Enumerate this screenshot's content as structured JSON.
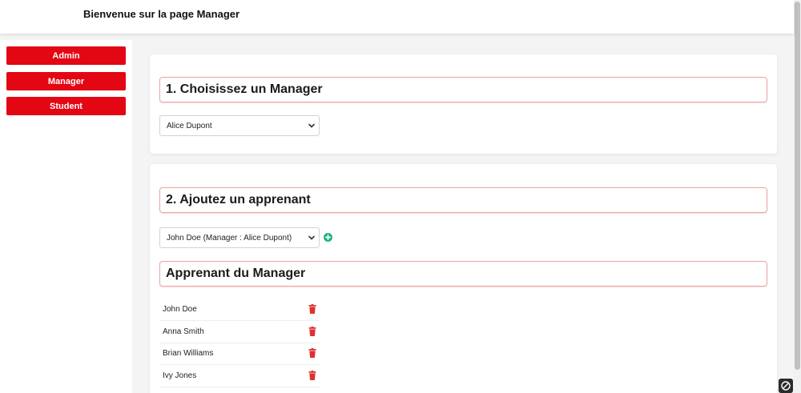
{
  "header": {
    "title": "Bienvenue sur la page Manager"
  },
  "sidebar": {
    "items": [
      {
        "label": "Admin"
      },
      {
        "label": "Manager"
      },
      {
        "label": "Student"
      }
    ]
  },
  "section1": {
    "title": "1. Choisissez un Manager",
    "manager_select": {
      "value": "Alice Dupont"
    }
  },
  "section2": {
    "title": "2. Ajoutez un apprenant",
    "learner_select": {
      "value": "John Doe (Manager : Alice Dupont)"
    },
    "add_icon": "plus-circle-icon",
    "list_title": "Apprenant du Manager",
    "learners": [
      {
        "name": "John Doe"
      },
      {
        "name": "Anna Smith"
      },
      {
        "name": "Brian Williams"
      },
      {
        "name": "Ivy Jones"
      }
    ],
    "delete_icon": "trash-icon"
  },
  "colors": {
    "accent": "#e30613",
    "add": "#1ab378",
    "title_border": "#e8a4a4",
    "delete": "#e03131"
  }
}
